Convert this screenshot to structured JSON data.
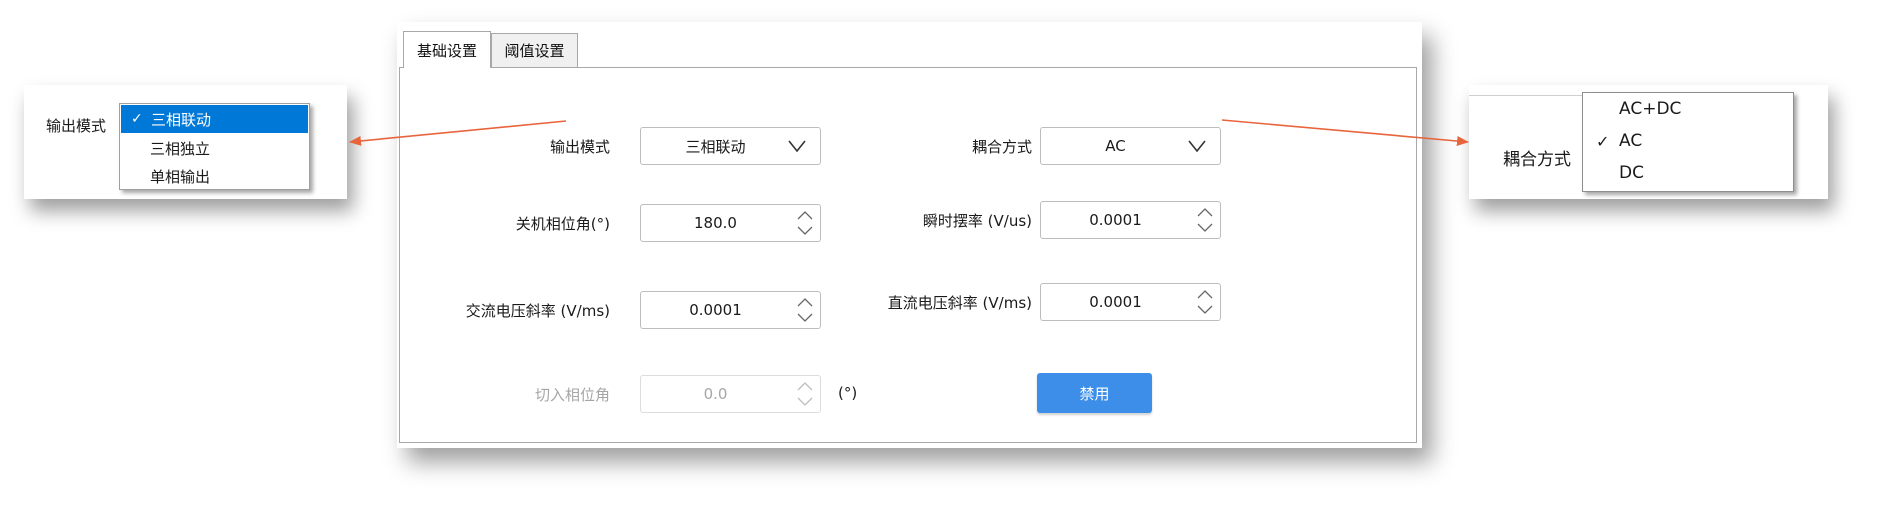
{
  "tabs": [
    {
      "label": "基础设置",
      "active": true
    },
    {
      "label": "阈值设置",
      "active": false
    }
  ],
  "form": {
    "output_mode": {
      "label": "输出模式",
      "value": "三相联动"
    },
    "coupling": {
      "label": "耦合方式",
      "value": "AC"
    },
    "shutdown_phase": {
      "label": "关机相位角(°)",
      "value": "180.0"
    },
    "instant_slew": {
      "label": "瞬时摆率 (V/us)",
      "value": "0.0001"
    },
    "ac_slope": {
      "label": "交流电压斜率 (V/ms)",
      "value": "0.0001"
    },
    "dc_slope": {
      "label": "直流电压斜率 (V/ms)",
      "value": "0.0001"
    },
    "cut_in_phase": {
      "label": "切入相位角",
      "value": "0.0",
      "unit": "(°)",
      "disabled": true
    },
    "disable_button": "禁用"
  },
  "left_callout": {
    "label": "输出模式",
    "options": [
      "三相联动",
      "三相独立",
      "单相输出"
    ],
    "selected": "三相联动",
    "check": "✓"
  },
  "right_callout": {
    "label": "耦合方式",
    "options": [
      "AC+DC",
      "AC",
      "DC"
    ],
    "selected": "AC",
    "check": "✓"
  },
  "colors": {
    "accent": "#0078d7",
    "button": "#3c8ee8",
    "arrow": "#e8643c"
  },
  "icons": [
    "chevron-down-icon",
    "spin-up-icon",
    "spin-down-icon",
    "check-icon"
  ]
}
